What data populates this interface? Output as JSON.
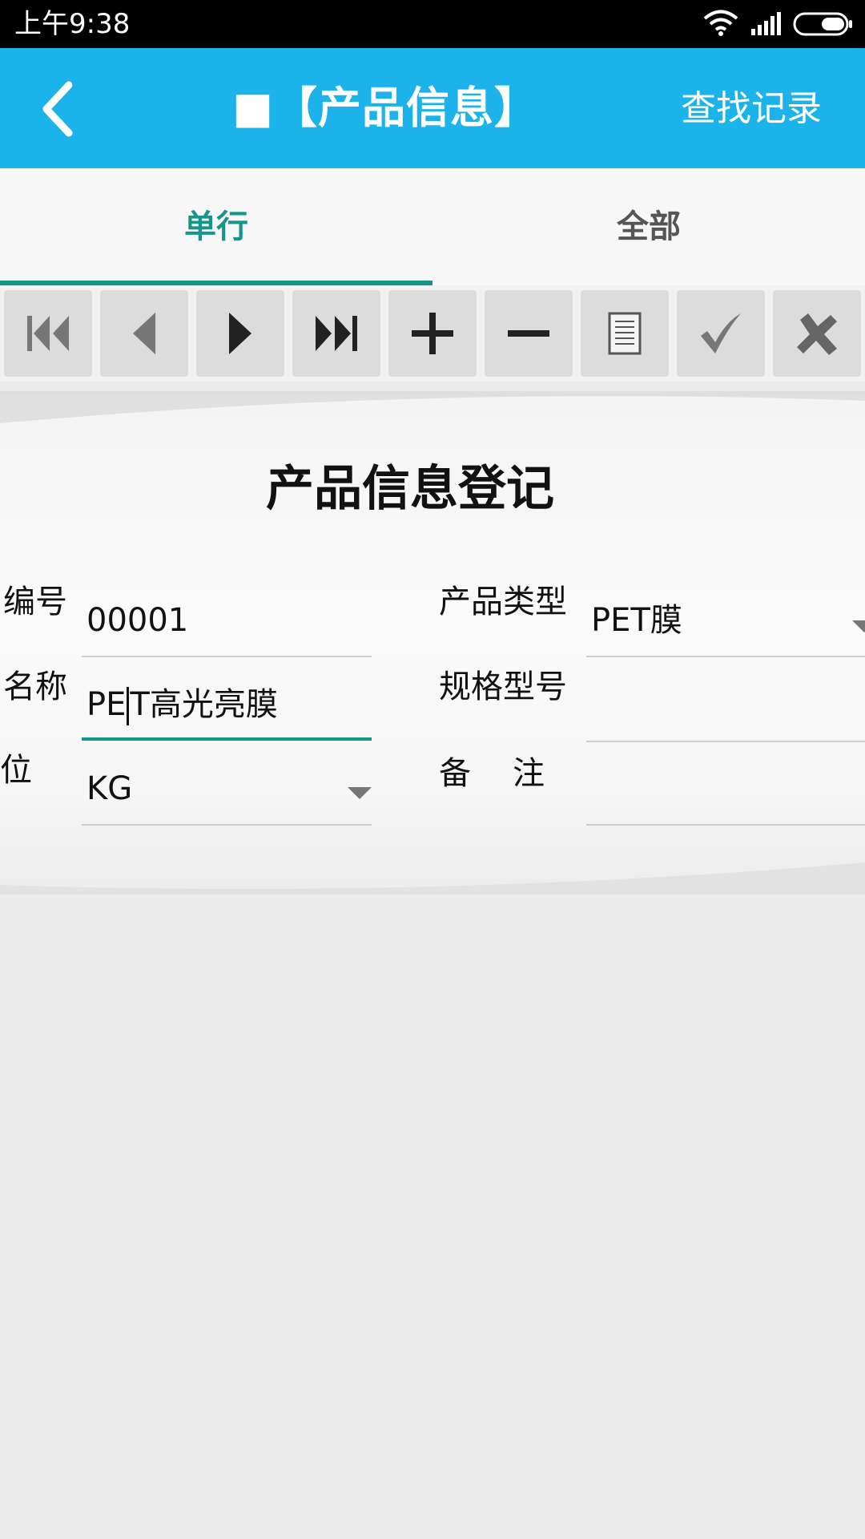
{
  "status_bar": {
    "time": "上午9:38",
    "icons": [
      "wifi-icon",
      "signal-icon",
      "battery-icon"
    ]
  },
  "app_bar": {
    "title": "■【产品信息】",
    "find_label": "查找记录",
    "back_icon": "chevron-left-icon",
    "color": "#1bb3ea"
  },
  "tabs": [
    {
      "label": "单行",
      "active": true
    },
    {
      "label": "全部",
      "active": false
    }
  ],
  "toolbar": {
    "buttons": [
      "first-record-icon",
      "previous-record-icon",
      "next-record-icon",
      "last-record-icon",
      "add-icon",
      "remove-icon",
      "document-icon",
      "confirm-check-icon",
      "cancel-x-icon"
    ]
  },
  "form": {
    "title": "产品信息登记",
    "fields": {
      "code": {
        "label": "编号",
        "value": "00001"
      },
      "product_type": {
        "label": "产品类型",
        "value": "PET膜"
      },
      "name": {
        "label": "名称",
        "value_before_caret": "PE",
        "value_after_caret": "T高光亮膜"
      },
      "spec_model": {
        "label": "规格型号",
        "value": ""
      },
      "unit": {
        "label": "位",
        "value": "KG"
      },
      "remark": {
        "label": "备　注",
        "value": ""
      }
    },
    "accent_color": "#14978a"
  }
}
